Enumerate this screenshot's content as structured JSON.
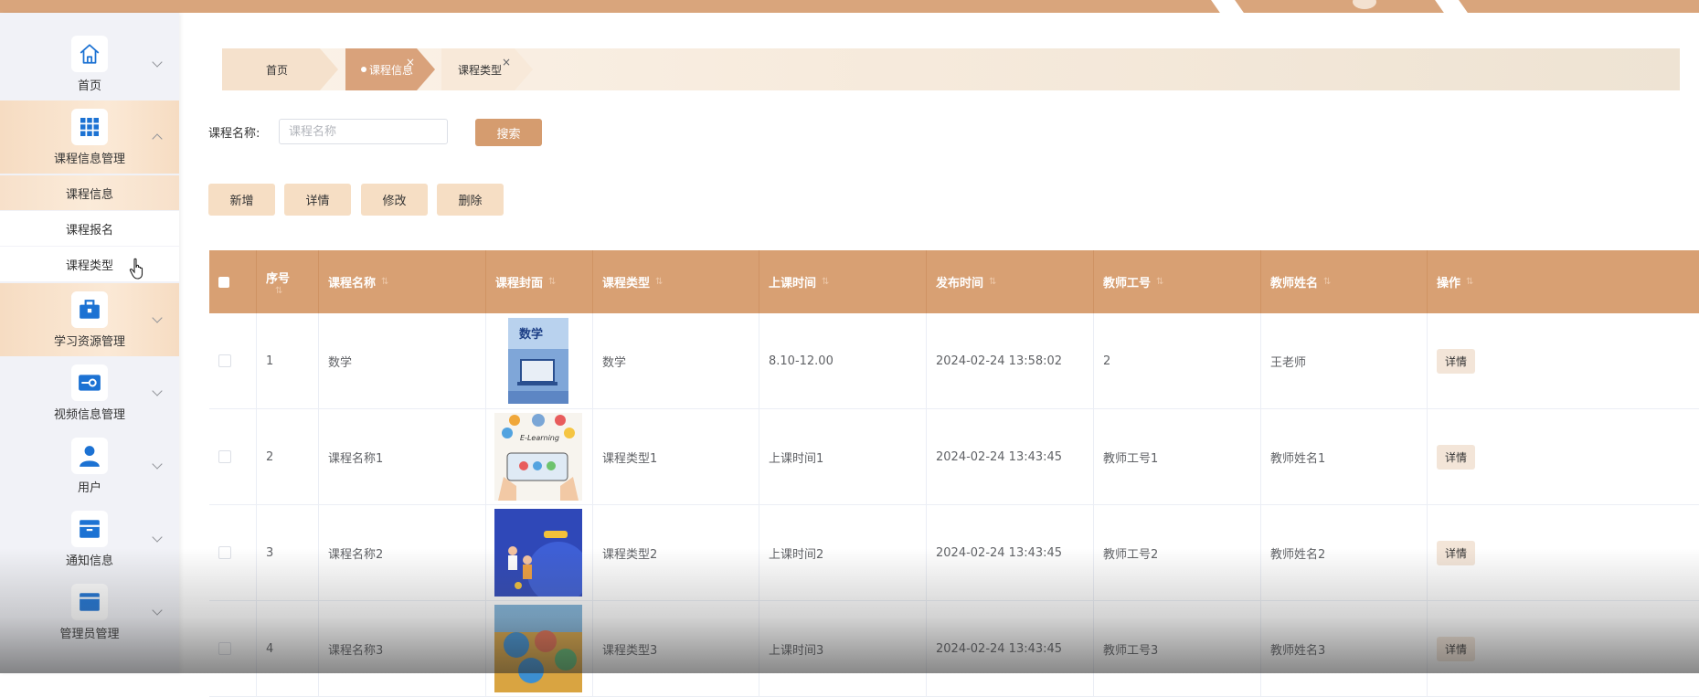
{
  "sidebar": {
    "items": [
      {
        "label": "首页",
        "icon": "home-icon"
      },
      {
        "label": "课程信息管理",
        "icon": "grid-icon",
        "expanded": true,
        "children": [
          {
            "label": "课程信息"
          },
          {
            "label": "课程报名"
          },
          {
            "label": "课程类型"
          }
        ]
      },
      {
        "label": "学习资源管理",
        "icon": "briefcase-icon"
      },
      {
        "label": "视频信息管理",
        "icon": "video-icon"
      },
      {
        "label": "用户",
        "icon": "user-icon"
      },
      {
        "label": "通知信息",
        "icon": "inbox-icon"
      },
      {
        "label": "管理员管理",
        "icon": "admin-icon"
      }
    ]
  },
  "tabs": [
    {
      "label": "首页"
    },
    {
      "label": "课程信息",
      "close": "×"
    },
    {
      "label": "课程类型",
      "close": "×"
    }
  ],
  "search": {
    "label": "课程名称:",
    "placeholder": "课程名称",
    "button": "搜索"
  },
  "actions": {
    "add": "新增",
    "detail": "详情",
    "edit": "修改",
    "delete": "删除"
  },
  "table": {
    "columns": [
      "序号",
      "课程名称",
      "课程封面",
      "课程类型",
      "上课时间",
      "发布时间",
      "教师工号",
      "教师姓名",
      "操作"
    ],
    "rows": [
      {
        "seq": "1",
        "name": "数学",
        "type": "数学",
        "time": "8.10-12.00",
        "published": "2024-02-24 13:58:02",
        "teacher_id": "2",
        "teacher_name": "王老师",
        "action": "详情"
      },
      {
        "seq": "2",
        "name": "课程名称1",
        "type": "课程类型1",
        "time": "上课时间1",
        "published": "2024-02-24 13:43:45",
        "teacher_id": "教师工号1",
        "teacher_name": "教师姓名1",
        "action": "详情"
      },
      {
        "seq": "3",
        "name": "课程名称2",
        "type": "课程类型2",
        "time": "上课时间2",
        "published": "2024-02-24 13:43:45",
        "teacher_id": "教师工号2",
        "teacher_name": "教师姓名2",
        "action": "详情"
      },
      {
        "seq": "4",
        "name": "课程名称3",
        "type": "课程类型3",
        "time": "上课时间3",
        "published": "2024-02-24 13:43:45",
        "teacher_id": "教师工号3",
        "teacher_name": "教师姓名3",
        "action": "详情"
      }
    ],
    "covers": [
      "数学",
      "E-Learning",
      "",
      ""
    ]
  },
  "colors": {
    "accent": "#d59c6f",
    "header": "#d8a073",
    "topbar": "#d9a57c",
    "sidebar_bg": "#f1f2f7"
  }
}
